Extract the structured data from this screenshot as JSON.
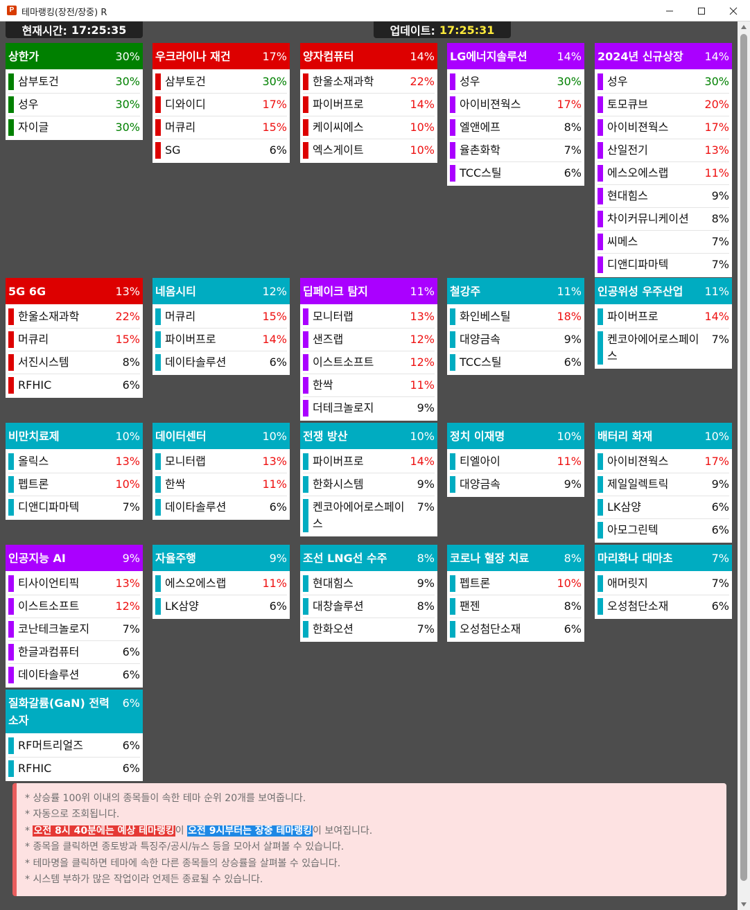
{
  "window": {
    "icon_letter": "P",
    "title": "테마랭킹(장전/장중) R"
  },
  "times": {
    "now_label": "현재시간:",
    "now_value": "17:25:35",
    "update_label": "업데이트:",
    "update_value": "17:25:31"
  },
  "colors": {
    "green": "#008000",
    "red": "#dd0000",
    "purple": "#aa00ff",
    "teal": "#00acc1",
    "up": "#ee1111",
    "neutral": "#111111"
  },
  "themes": [
    {
      "name": "상한가",
      "pct": "30%",
      "color": "green",
      "stocks": [
        {
          "name": "삼부토건",
          "pct": "30%",
          "tone": "green"
        },
        {
          "name": "성우",
          "pct": "30%",
          "tone": "green"
        },
        {
          "name": "자이글",
          "pct": "30%",
          "tone": "green"
        }
      ]
    },
    {
      "name": "우크라이나 재건",
      "pct": "17%",
      "color": "red",
      "stocks": [
        {
          "name": "삼부토건",
          "pct": "30%",
          "tone": "green"
        },
        {
          "name": "디와이디",
          "pct": "17%",
          "tone": "up"
        },
        {
          "name": "머큐리",
          "pct": "15%",
          "tone": "up"
        },
        {
          "name": "SG",
          "pct": "6%",
          "tone": "neutral"
        }
      ]
    },
    {
      "name": "양자컴퓨터",
      "pct": "14%",
      "color": "red",
      "stocks": [
        {
          "name": "한울소재과학",
          "pct": "22%",
          "tone": "up"
        },
        {
          "name": "파이버프로",
          "pct": "14%",
          "tone": "up"
        },
        {
          "name": "케이씨에스",
          "pct": "10%",
          "tone": "up"
        },
        {
          "name": "엑스게이트",
          "pct": "10%",
          "tone": "up"
        }
      ]
    },
    {
      "name": "LG에너지솔루션",
      "pct": "14%",
      "color": "purple",
      "stocks": [
        {
          "name": "성우",
          "pct": "30%",
          "tone": "green"
        },
        {
          "name": "아이비젼웍스",
          "pct": "17%",
          "tone": "up"
        },
        {
          "name": "엘앤에프",
          "pct": "8%",
          "tone": "neutral"
        },
        {
          "name": "율촌화학",
          "pct": "7%",
          "tone": "neutral"
        },
        {
          "name": "TCC스틸",
          "pct": "6%",
          "tone": "neutral"
        }
      ]
    },
    {
      "name": "2024년 신규상장",
      "pct": "14%",
      "color": "purple",
      "stocks": [
        {
          "name": "성우",
          "pct": "30%",
          "tone": "green"
        },
        {
          "name": "토모큐브",
          "pct": "20%",
          "tone": "up"
        },
        {
          "name": "아이비젼웍스",
          "pct": "17%",
          "tone": "up"
        },
        {
          "name": "산일전기",
          "pct": "13%",
          "tone": "up"
        },
        {
          "name": "에스오에스랩",
          "pct": "11%",
          "tone": "up"
        },
        {
          "name": "현대힘스",
          "pct": "9%",
          "tone": "neutral"
        },
        {
          "name": "차이커뮤니케이션",
          "pct": "8%",
          "tone": "neutral"
        },
        {
          "name": "씨메스",
          "pct": "7%",
          "tone": "neutral"
        },
        {
          "name": "디앤디파마텍",
          "pct": "7%",
          "tone": "neutral"
        }
      ]
    },
    {
      "name": "5G 6G",
      "pct": "13%",
      "color": "red",
      "stocks": [
        {
          "name": "한울소재과학",
          "pct": "22%",
          "tone": "up"
        },
        {
          "name": "머큐리",
          "pct": "15%",
          "tone": "up"
        },
        {
          "name": "서진시스템",
          "pct": "8%",
          "tone": "neutral"
        },
        {
          "name": "RFHIC",
          "pct": "6%",
          "tone": "neutral"
        }
      ]
    },
    {
      "name": "네옴시티",
      "pct": "12%",
      "color": "teal",
      "stocks": [
        {
          "name": "머큐리",
          "pct": "15%",
          "tone": "up"
        },
        {
          "name": "파이버프로",
          "pct": "14%",
          "tone": "up"
        },
        {
          "name": "데이타솔루션",
          "pct": "6%",
          "tone": "neutral"
        }
      ]
    },
    {
      "name": "딥페이크 탐지",
      "pct": "11%",
      "color": "purple",
      "stocks": [
        {
          "name": "모니터랩",
          "pct": "13%",
          "tone": "up"
        },
        {
          "name": "샌즈랩",
          "pct": "12%",
          "tone": "up"
        },
        {
          "name": "이스트소프트",
          "pct": "12%",
          "tone": "up"
        },
        {
          "name": "한싹",
          "pct": "11%",
          "tone": "up"
        },
        {
          "name": "더테크놀로지",
          "pct": "9%",
          "tone": "neutral"
        }
      ]
    },
    {
      "name": "철강주",
      "pct": "11%",
      "color": "teal",
      "stocks": [
        {
          "name": "화인베스틸",
          "pct": "18%",
          "tone": "up"
        },
        {
          "name": "대양금속",
          "pct": "9%",
          "tone": "neutral"
        },
        {
          "name": "TCC스틸",
          "pct": "6%",
          "tone": "neutral"
        }
      ]
    },
    {
      "name": "인공위성 우주산업",
      "pct": "11%",
      "color": "teal",
      "stocks": [
        {
          "name": "파이버프로",
          "pct": "14%",
          "tone": "up"
        },
        {
          "name": "켄코아에어로스페이스",
          "pct": "7%",
          "tone": "neutral"
        }
      ]
    },
    {
      "name": "비만치료제",
      "pct": "10%",
      "color": "teal",
      "stocks": [
        {
          "name": "올릭스",
          "pct": "13%",
          "tone": "up"
        },
        {
          "name": "펩트론",
          "pct": "10%",
          "tone": "up"
        },
        {
          "name": "디앤디파마텍",
          "pct": "7%",
          "tone": "neutral"
        }
      ]
    },
    {
      "name": "데이터센터",
      "pct": "10%",
      "color": "teal",
      "stocks": [
        {
          "name": "모니터랩",
          "pct": "13%",
          "tone": "up"
        },
        {
          "name": "한싹",
          "pct": "11%",
          "tone": "up"
        },
        {
          "name": "데이타솔루션",
          "pct": "6%",
          "tone": "neutral"
        }
      ]
    },
    {
      "name": "전쟁 방산",
      "pct": "10%",
      "color": "teal",
      "stocks": [
        {
          "name": "파이버프로",
          "pct": "14%",
          "tone": "up"
        },
        {
          "name": "한화시스템",
          "pct": "9%",
          "tone": "neutral"
        },
        {
          "name": "켄코아에어로스페이스",
          "pct": "7%",
          "tone": "neutral"
        }
      ]
    },
    {
      "name": "정치 이재명",
      "pct": "10%",
      "color": "teal",
      "stocks": [
        {
          "name": "티엘아이",
          "pct": "11%",
          "tone": "up"
        },
        {
          "name": "대양금속",
          "pct": "9%",
          "tone": "neutral"
        }
      ]
    },
    {
      "name": "배터리 화재",
      "pct": "10%",
      "color": "teal",
      "stocks": [
        {
          "name": "아이비젼웍스",
          "pct": "17%",
          "tone": "up"
        },
        {
          "name": "제일일렉트릭",
          "pct": "9%",
          "tone": "neutral"
        },
        {
          "name": "LK삼양",
          "pct": "6%",
          "tone": "neutral"
        },
        {
          "name": "아모그린텍",
          "pct": "6%",
          "tone": "neutral"
        }
      ]
    },
    {
      "name": "인공지능 AI",
      "pct": "9%",
      "color": "purple",
      "stocks": [
        {
          "name": "티사이언티픽",
          "pct": "13%",
          "tone": "up"
        },
        {
          "name": "이스트소프트",
          "pct": "12%",
          "tone": "up"
        },
        {
          "name": "코난테크놀로지",
          "pct": "7%",
          "tone": "neutral"
        },
        {
          "name": "한글과컴퓨터",
          "pct": "6%",
          "tone": "neutral"
        },
        {
          "name": "데이타솔루션",
          "pct": "6%",
          "tone": "neutral"
        }
      ]
    },
    {
      "name": "자율주행",
      "pct": "9%",
      "color": "teal",
      "stocks": [
        {
          "name": "에스오에스랩",
          "pct": "11%",
          "tone": "up"
        },
        {
          "name": "LK삼양",
          "pct": "6%",
          "tone": "neutral"
        }
      ]
    },
    {
      "name": "조선 LNG선 수주",
      "pct": "8%",
      "color": "teal",
      "stocks": [
        {
          "name": "현대힘스",
          "pct": "9%",
          "tone": "neutral"
        },
        {
          "name": "대창솔루션",
          "pct": "8%",
          "tone": "neutral"
        },
        {
          "name": "한화오션",
          "pct": "7%",
          "tone": "neutral"
        }
      ]
    },
    {
      "name": "코로나 혈장 치료",
      "pct": "8%",
      "color": "teal",
      "stocks": [
        {
          "name": "펩트론",
          "pct": "10%",
          "tone": "up"
        },
        {
          "name": "팬젠",
          "pct": "8%",
          "tone": "neutral"
        },
        {
          "name": "오성첨단소재",
          "pct": "6%",
          "tone": "neutral"
        }
      ]
    },
    {
      "name": "마리화나 대마초",
      "pct": "7%",
      "color": "teal",
      "stocks": [
        {
          "name": "애머릿지",
          "pct": "7%",
          "tone": "neutral"
        },
        {
          "name": "오성첨단소재",
          "pct": "6%",
          "tone": "neutral"
        }
      ]
    },
    {
      "name": "질화갈륨(GaN) 전력소자",
      "pct": "6%",
      "color": "teal",
      "stocks": [
        {
          "name": "RF머트리얼즈",
          "pct": "6%",
          "tone": "neutral"
        },
        {
          "name": "RFHIC",
          "pct": "6%",
          "tone": "neutral"
        }
      ]
    }
  ],
  "notice": {
    "line1": "* 상승률 100위 이내의 종목들이 속한 테마 순위 20개를 보여줍니다.",
    "line2": "* 자동으로 조회됩니다.",
    "line3_prefix": "* ",
    "line3_red": "오전 8시 40분에는 예상 테마랭킹",
    "line3_mid": "이 ",
    "line3_blue": "오전 9시부터는 장중 테마랭킹",
    "line3_suffix": "이 보여집니다.",
    "line4": "* 종목을 클릭하면 종토방과 특징주/공시/뉴스 등을 모아서 살펴볼 수 있습니다.",
    "line5": "* 테마명을 클릭하면 테마에 속한 다른 종목들의 상승률을 살펴볼 수 있습니다.",
    "line6": "* 시스템 부하가 많은 작업이라 언제든 종료될 수 있습니다."
  }
}
